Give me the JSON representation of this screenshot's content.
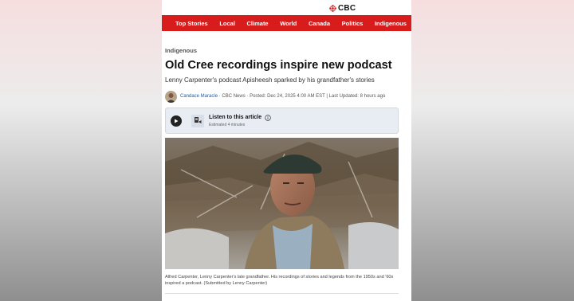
{
  "brand": {
    "logo_text": "CBC",
    "accent_color": "#d81b1b"
  },
  "nav": {
    "items": [
      "Top Stories",
      "Local",
      "Climate",
      "World",
      "Canada",
      "Politics",
      "Indigenous"
    ]
  },
  "article": {
    "kicker": "Indigenous",
    "headline": "Old Cree recordings inspire new podcast",
    "subhead": "Lenny Carpenter's podcast Apisheesh sparked by his grandfather's stories",
    "byline": {
      "author": "Candace Maracle",
      "separator1": " · ",
      "outlet": "CBC News",
      "separator2": " · ",
      "posted": "Posted: Dec 24, 2025 4:00 AM EST | Last Updated: 8 hours ago"
    },
    "audio": {
      "title": "Listen to this article",
      "estimate": "Estimated 4 minutes"
    },
    "photo_caption": "Alfred Carpenter, Lenny Carpenter's late grandfather. His recordings of stories and legends from the 1950s and '60s inspired a podcast. (Submitted by Lenny Carpenter)"
  },
  "icons": {
    "logo": "cbc-gem-icon",
    "play": "play-icon",
    "audio": "audio-article-icon",
    "info": "info-icon"
  }
}
